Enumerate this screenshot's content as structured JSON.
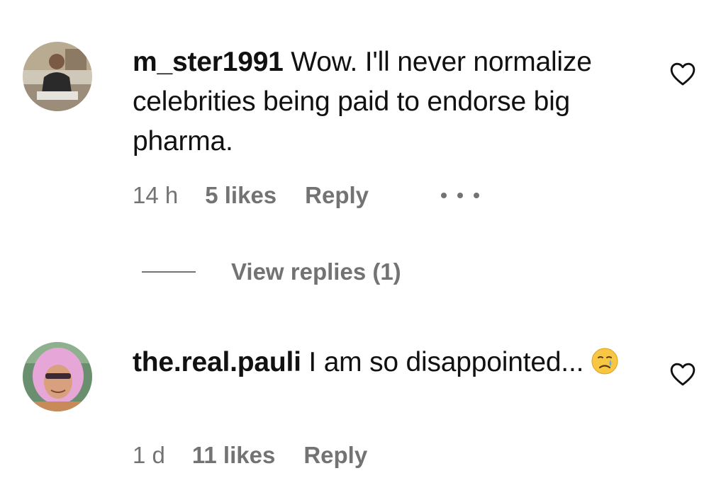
{
  "comments": [
    {
      "username": "m_ster1991",
      "text": " Wow. I'll never normalize celebrities being paid to endorse big pharma.",
      "time": "14 h",
      "likes": "5 likes",
      "reply_label": "Reply",
      "avatar_icon": "user-photo-avatar",
      "heart_icon": "heart-outline-icon",
      "more_icon": "more-options-icon"
    },
    {
      "username": "the.real.pauli",
      "text": " I am so disappointed...",
      "emoji": "crying-face-emoji",
      "time": "1 d",
      "likes": "11 likes",
      "reply_label": "Reply",
      "avatar_icon": "user-photo-avatar",
      "heart_icon": "heart-outline-icon"
    }
  ],
  "view_replies": {
    "label": "View replies (1)"
  },
  "colors": {
    "text": "#111111",
    "muted": "#737373",
    "background": "#ffffff"
  }
}
